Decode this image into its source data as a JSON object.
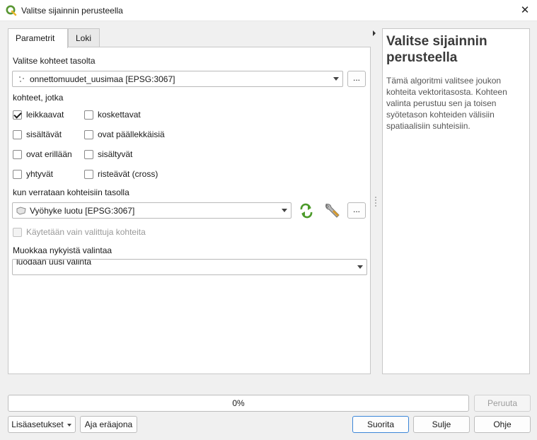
{
  "window": {
    "title": "Valitse sijainnin perusteella",
    "close_glyph": "✕"
  },
  "tabs": [
    {
      "label": "Parametrit",
      "active": true
    },
    {
      "label": "Loki",
      "active": false
    }
  ],
  "params": {
    "select_from_label": "Valitse kohteet tasolta",
    "select_layer_value": "onnettomuudet_uusimaa [EPSG:3067]",
    "where_label": "kohteet, jotka",
    "predicates": [
      {
        "label": "leikkaavat",
        "checked": true
      },
      {
        "label": "koskettavat",
        "checked": false
      },
      {
        "label": "sisältävät",
        "checked": false
      },
      {
        "label": "ovat päällekkäisiä",
        "checked": false
      },
      {
        "label": "ovat erillään",
        "checked": false
      },
      {
        "label": "sisältyvät",
        "checked": false
      },
      {
        "label": "yhtyvät",
        "checked": false
      },
      {
        "label": "risteävät (cross)",
        "checked": false
      }
    ],
    "compare_label": "kun verrataan kohteisiin tasolla",
    "compare_layer_value": "Vyöhyke luotu [EPSG:3067]",
    "selected_only_label": "Käytetään vain valittuja kohteita",
    "modify_label": "Muokkaa nykyistä valintaa",
    "modify_value": "luodaan uusi valinta",
    "ellipsis_label": "...",
    "icons": {
      "point_layer": "point-layer-icon",
      "polygon_layer": "polygon-layer-icon",
      "iterate": "iterate-icon",
      "settings": "wrench-icon"
    }
  },
  "help": {
    "title": "Valitse sijainnin perusteella",
    "text": "Tämä algoritmi valitsee joukon kohteita vektoritasosta. Kohteen valinta perustuu sen ja toisen syötetason kohteiden välisiin spatiaalisiin suhteisiin."
  },
  "progress": {
    "value_text": "0%",
    "cancel_label": "Peruuta"
  },
  "buttons": {
    "advanced": "Lisäasetukset",
    "batch": "Aja eräajona",
    "run": "Suorita",
    "close": "Sulje",
    "help": "Ohje"
  },
  "colors": {
    "qgis_green": "#589632",
    "primary_border": "#3b86d8"
  }
}
